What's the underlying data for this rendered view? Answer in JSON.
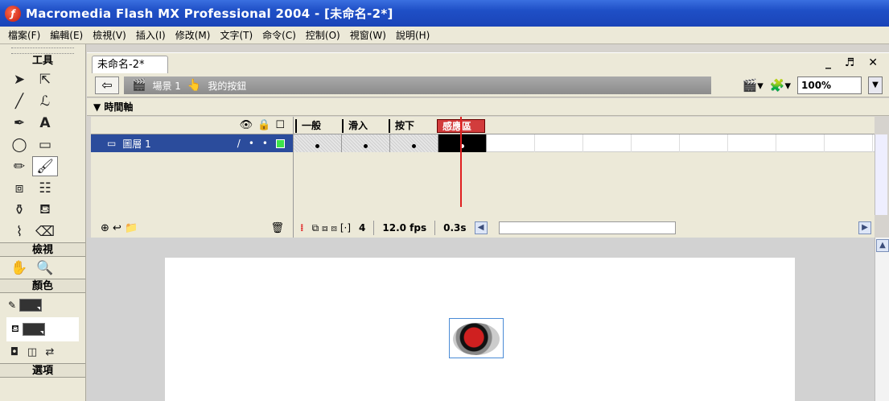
{
  "window": {
    "title": "Macromedia Flash MX Professional 2004 - [未命名-2*]",
    "icon": "flash-app-icon"
  },
  "menubar": [
    "檔案(F)",
    "編輯(E)",
    "檢視(V)",
    "插入(I)",
    "修改(M)",
    "文字(T)",
    "命令(C)",
    "控制(O)",
    "視窗(W)",
    "說明(H)"
  ],
  "tools": {
    "header": "工具",
    "view_header": "檢視",
    "color_header": "顏色",
    "options_header": "選項"
  },
  "document": {
    "tab_label": "未命名-2*",
    "window_controls": "_ ♬ ✕",
    "scene_label": "場景 1",
    "symbol_label": "我的按鈕",
    "zoom": "100%"
  },
  "timeline": {
    "title": "時間軸",
    "layer_name": "圖層 1",
    "frame_labels": [
      "一般",
      "滑入",
      "按下",
      "感應區"
    ],
    "current_frame": "4",
    "fps": "12.0 fps",
    "time": "0.3s"
  },
  "colors": {
    "titlebar": "#1f4fc6",
    "layer_selected": "#2b4c9c",
    "playhead": "#e02020",
    "hit_label": "#d23c3c"
  }
}
